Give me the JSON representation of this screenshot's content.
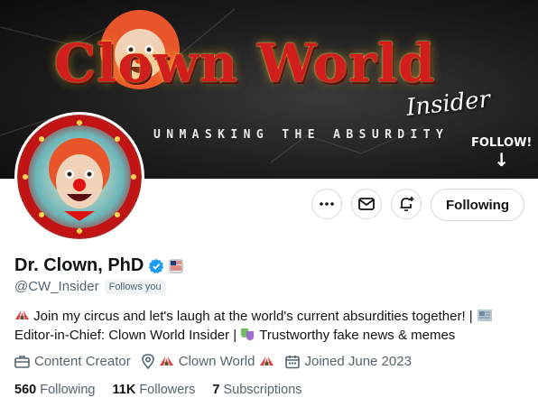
{
  "banner": {
    "title": "Clown World",
    "subtitle": "Insider",
    "tagline": "UNMASKING THE ABSURDITY",
    "follow_text": "FOLLOW!"
  },
  "profile": {
    "display_name": "Dr. Clown, PhD",
    "handle": "@CW_Insider",
    "follows_you": "Follows you",
    "bio_line1": "Join my circus and let's laugh at the world's current absurdities together! |",
    "bio_line2a": "Editor-in-Chief: Clown World Insider |",
    "bio_line2b": "Trustworthy fake news & memes",
    "category": "Content Creator",
    "location": "Clown World",
    "joined": "Joined June 2023"
  },
  "actions": {
    "more": "more-icon",
    "message": "envelope-icon",
    "notify": "bell-plus-icon",
    "follow_label": "Following"
  },
  "stats": {
    "following_count": "560",
    "following_label": "Following",
    "followers_count": "11K",
    "followers_label": "Followers",
    "subs_count": "7",
    "subs_label": "Subscriptions"
  },
  "colors": {
    "verified": "#1d9bf0",
    "muted": "#536471",
    "banner_red": "#d21d1d"
  }
}
